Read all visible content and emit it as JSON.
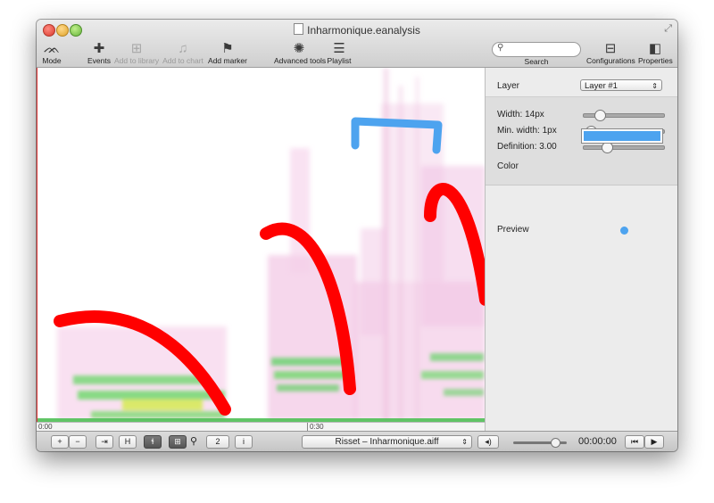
{
  "window": {
    "title": "Inharmonique.eanalysis"
  },
  "toolbar": {
    "mode": "Mode",
    "events": "Events",
    "add_library": "Add to library",
    "add_chart": "Add to chart",
    "add_marker": "Add marker",
    "advanced_tools": "Advanced tools",
    "playlist": "Playlist",
    "search_label": "Search",
    "configurations": "Configurations",
    "properties": "Properties"
  },
  "timeline": {
    "start": "0:00",
    "mark": "0:30"
  },
  "bottom": {
    "zoom_in": "+",
    "zoom_out": "−",
    "fit": "⇥",
    "h": "H",
    "mode_toggle": "ɬ",
    "grid_toggle": "⊞",
    "page": "2",
    "info": "i",
    "file": "Risset – Inharmonique.aiff",
    "volume": "◂)",
    "time": "00:00:00",
    "rewind": "⏮",
    "play": "▶"
  },
  "properties": {
    "layer_label": "Layer",
    "layer_value": "Layer #1",
    "width_label": "Width: 14px",
    "width_value": 0.15,
    "min_width_label": "Min. width:  1px",
    "min_width_value": 0.02,
    "definition_label": "Definition: 3.00",
    "definition_value": 0.25,
    "color_label": "Color",
    "preview_label": "Preview"
  },
  "colors": {
    "pen_blue": "#4da3ef",
    "pen_red": "#ff0000",
    "swatch": "#4da3ef"
  }
}
